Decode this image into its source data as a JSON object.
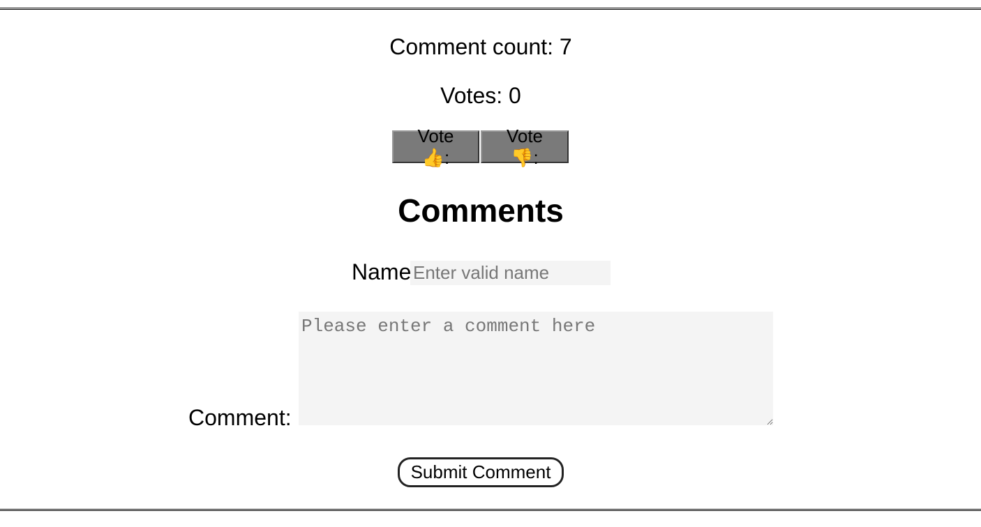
{
  "stats": {
    "comment_count": "Comment count: 7",
    "votes": "Votes: 0"
  },
  "vote_buttons": {
    "up_label": "Vote 👍:",
    "down_label": "Vote 👎:"
  },
  "comments_section": {
    "heading": "Comments",
    "name_label": "Name",
    "name_placeholder": "Enter valid name",
    "comment_label": "Comment:",
    "comment_placeholder": "Please enter a comment here",
    "submit_label": "Submit Comment"
  }
}
